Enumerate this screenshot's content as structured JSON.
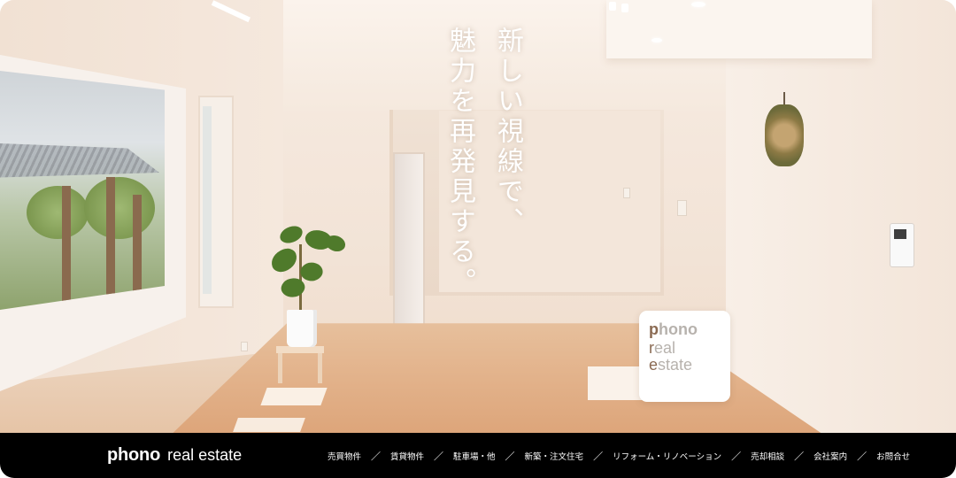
{
  "hero": {
    "catchphrase_line1": "新しい視線で、",
    "catchphrase_line2": "魅力を再発見する。"
  },
  "logo_card": {
    "line1": "phono",
    "line2": "real",
    "line3": "estate",
    "accent_color": "#8a6a52",
    "muted_color": "#b7b2ad"
  },
  "navbar": {
    "brand_bold": "phono",
    "brand_light": "real estate",
    "separator": "／",
    "items": [
      {
        "label": "売買物件"
      },
      {
        "label": "賃貸物件"
      },
      {
        "label": "駐車場・他"
      },
      {
        "label": "新築・注文住宅"
      },
      {
        "label": "リフォーム・リノベーション"
      },
      {
        "label": "売却相談"
      },
      {
        "label": "会社案内"
      },
      {
        "label": "お問合せ"
      }
    ],
    "background": "#000000",
    "text_color": "#ffffff"
  }
}
